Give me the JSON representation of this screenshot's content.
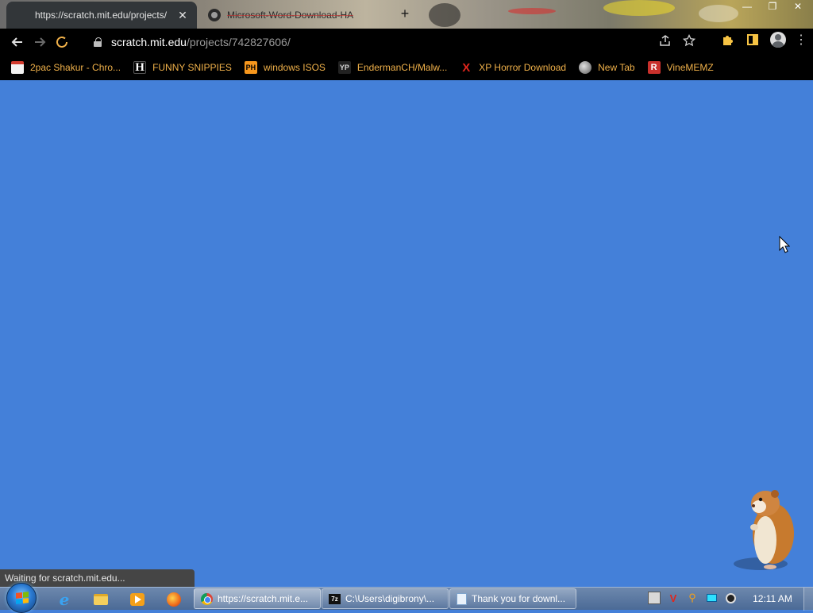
{
  "browser": {
    "tabs": [
      {
        "title": "https://scratch.mit.edu/projects/",
        "active": true
      },
      {
        "title": "Microsoft-Word-Download-HA",
        "active": false
      }
    ],
    "tab_close_glyph": "✕",
    "new_tab_glyph": "+",
    "window_controls": {
      "minimize": "—",
      "restore": "❐",
      "close": "✕"
    },
    "address": {
      "host": "scratch.mit.edu",
      "path": "/projects/742827606/"
    },
    "icons": {
      "back": "back-arrow-icon",
      "forward": "forward-arrow-icon",
      "stop": "stop-loading-icon",
      "lock": "lock-icon",
      "share": "share-icon",
      "bookmark_star": "star-icon",
      "extensions": "puzzle-icon",
      "side_panel": "side-panel-icon",
      "profile": "profile-icon",
      "menu": "kebab-menu-icon"
    },
    "bookmarks": [
      {
        "label": "2pac Shakur - Chro...",
        "icon": "store-icon"
      },
      {
        "label": "FUNNY SNIPPIES",
        "icon": "h-icon"
      },
      {
        "label": "windows ISOS",
        "icon": "ph-icon"
      },
      {
        "label": "EndermanCH/Malw...",
        "icon": "yp-icon"
      },
      {
        "label": "XP Horror Download",
        "icon": "x-icon"
      },
      {
        "label": "New Tab",
        "icon": "globe-icon"
      },
      {
        "label": "VineMEMZ",
        "icon": "r-icon"
      }
    ],
    "status_text": "Waiting for scratch.mit.edu..."
  },
  "page": {
    "background": "#4480d9"
  },
  "taskbar": {
    "tasks": [
      {
        "label": "https://scratch.mit.e...",
        "icon": "chrome-icon"
      },
      {
        "label": "C:\\Users\\digibrony\\...",
        "icon": "7zip-icon"
      },
      {
        "label": "Thank you for downl...",
        "icon": "notepad-icon"
      }
    ],
    "clock": "12:11 AM"
  },
  "colors": {
    "bookmark_text": "#f0b14a",
    "page_blue": "#4480d9",
    "toolbar_bg": "#000000"
  }
}
